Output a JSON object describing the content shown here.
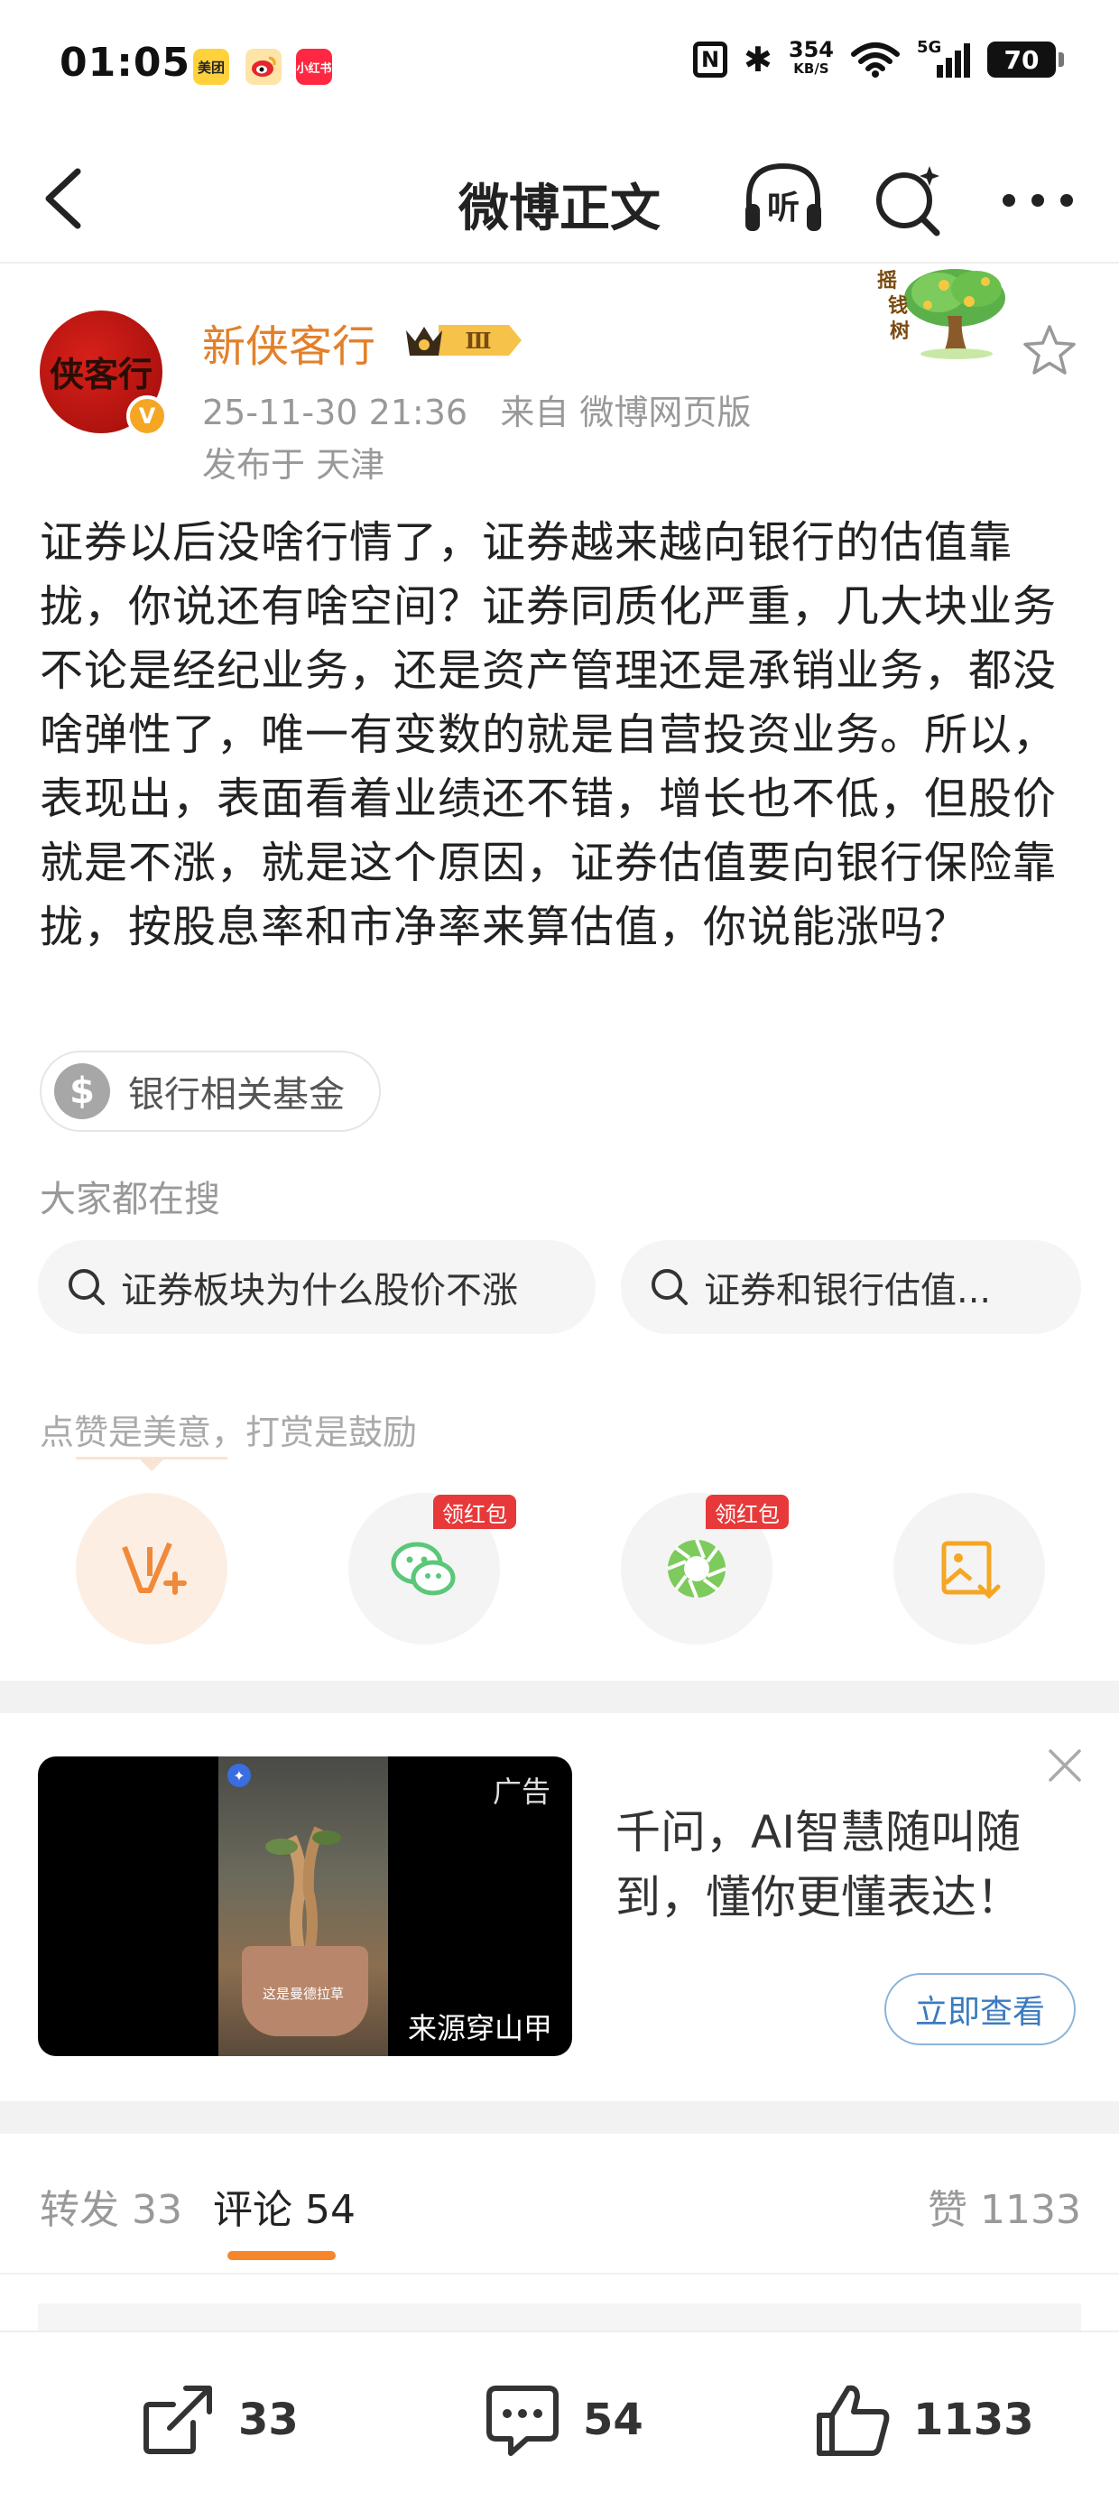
{
  "status_bar": {
    "time": "01:05",
    "apps": [
      "美团",
      "微博",
      "小红书"
    ],
    "net_speed_value": "354",
    "net_speed_unit": "KB/S",
    "network": "5G",
    "battery": "70"
  },
  "header": {
    "title": "微博正文"
  },
  "post": {
    "author": "新侠客行",
    "avatar_text": "侠客行",
    "vip_level": "Ⅲ",
    "time": "25-11-30 21:36",
    "source": "来自 微博网页版",
    "location": "发布于 天津",
    "money_tree": "摇钱树",
    "content": "证券以后没啥行情了，证券越来越向银行的估值靠拢，你说还有啥空间？证券同质化严重，几大块业务不论是经纪业务，还是资产管理还是承销业务，都没啥弹性了，唯一有变数的就是自营投资业务。所以，表现出，表面看着业绩还不错，增长也不低，但股价就是不涨，就是这个原因，证券估值要向银行保险靠拢，按股息率和市净率来算估值，你说能涨吗？",
    "topic_label": "银行相关基金"
  },
  "searching": {
    "title": "大家都在搜",
    "items": [
      "证券板块为什么股价不涨",
      "证券和银行估值..."
    ]
  },
  "reward": {
    "title": "点赞是美意，打赏是鼓励",
    "redpack_label": "领红包"
  },
  "ad": {
    "tag": "广告",
    "source": "来源穿山甲",
    "video_caption": "这是曼德拉草",
    "title": "千问，AI智慧随叫随到，懂你更懂表达！",
    "cta": "立即查看"
  },
  "tabs": {
    "repost": "转发 33",
    "comment": "评论 54",
    "like": "赞 1133"
  },
  "bottom_bar": {
    "repost_count": "33",
    "comment_count": "54",
    "like_count": "1133"
  },
  "colors": {
    "accent": "#f7852a",
    "author": "#e3802a",
    "redpack": "#e8393a",
    "wechat": "#5bc779",
    "gray_text": "#999999"
  }
}
